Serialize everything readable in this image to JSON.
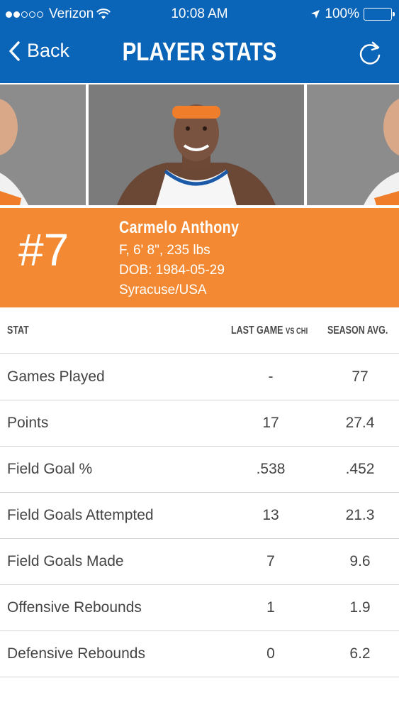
{
  "status_bar": {
    "carrier": "Verizon",
    "time": "10:08 AM",
    "battery": "100%",
    "signal_bars_filled": 2,
    "signal_bars_total": 5
  },
  "nav": {
    "back_label": "Back",
    "title": "PLAYER STATS",
    "refresh_icon": "refresh-icon"
  },
  "player": {
    "number": "#7",
    "name": "Carmelo Anthony",
    "position_size": "F, 6' 8\", 235 lbs",
    "dob": "DOB: 1984-05-29",
    "origin": "Syracuse/USA"
  },
  "table": {
    "headers": {
      "stat": "STAT",
      "last_game": "LAST GAME",
      "last_game_opponent": "VS CHI",
      "season_avg": "SEASON AVG."
    },
    "rows": [
      {
        "stat": "Games Played",
        "last": "-",
        "season": "77"
      },
      {
        "stat": "Points",
        "last": "17",
        "season": "27.4"
      },
      {
        "stat": "Field Goal %",
        "last": ".538",
        "season": ".452"
      },
      {
        "stat": "Field Goals Attempted",
        "last": "13",
        "season": "21.3"
      },
      {
        "stat": "Field Goals Made",
        "last": "7",
        "season": "9.6"
      },
      {
        "stat": "Offensive Rebounds",
        "last": "1",
        "season": "1.9"
      },
      {
        "stat": "Defensive Rebounds",
        "last": "0",
        "season": "6.2"
      }
    ]
  },
  "colors": {
    "header_blue": "#0a64b7",
    "accent_orange": "#f38a33"
  }
}
